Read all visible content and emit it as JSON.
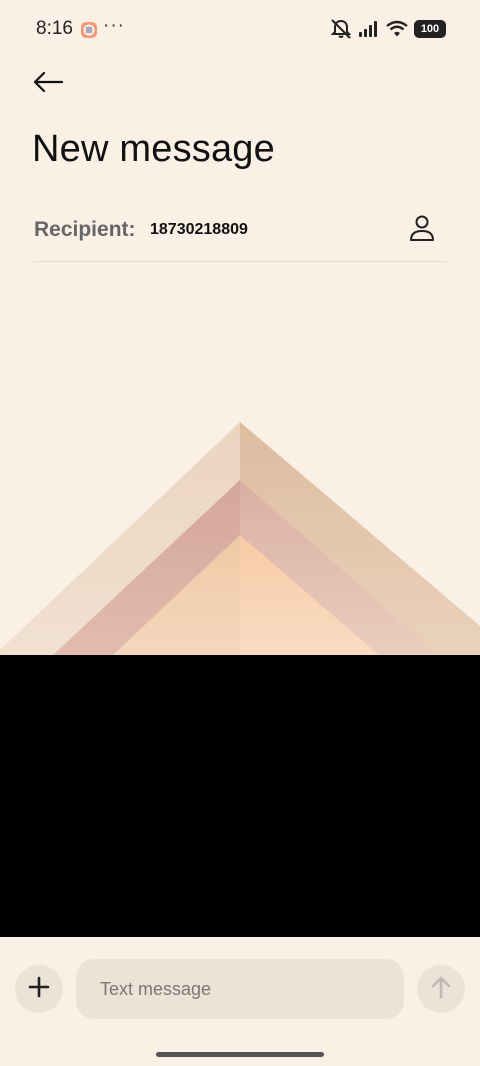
{
  "status_bar": {
    "time": "8:16",
    "more": "···",
    "battery": "100",
    "icons": [
      "app-notification-icon",
      "mute-icon",
      "signal-icon",
      "wifi-icon",
      "battery-icon"
    ]
  },
  "header": {
    "back_icon": "back-arrow-icon",
    "title": "New message"
  },
  "recipient": {
    "label": "Recipient:",
    "value": "18730218809",
    "contact_icon": "contact-person-icon"
  },
  "compose": {
    "add_icon": "plus-icon",
    "placeholder": "Text message",
    "value": "",
    "send_icon": "send-arrow-icon"
  },
  "colors": {
    "background": "#faf0e5",
    "input_bg": "#ebe2d8",
    "panel": "#000000"
  }
}
